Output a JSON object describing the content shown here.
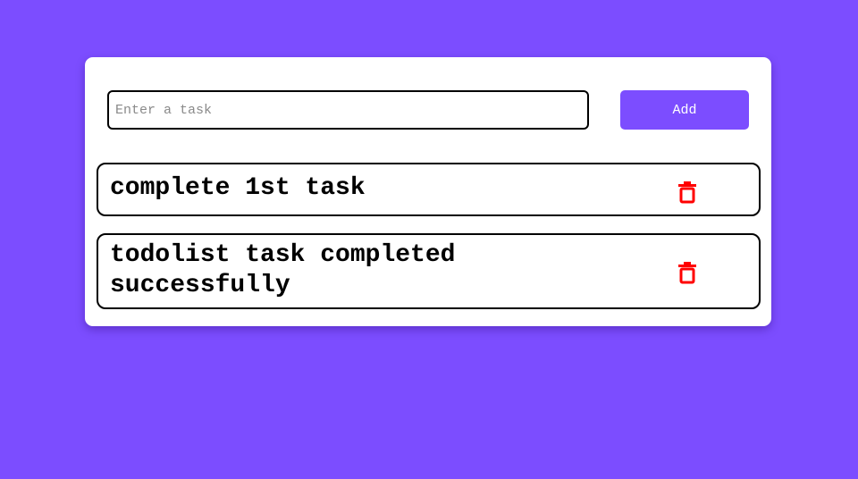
{
  "colors": {
    "background": "#7c4dff",
    "card": "#ffffff",
    "accent": "#7c4dff",
    "delete_icon": "#ff0000"
  },
  "input": {
    "placeholder": "Enter a task",
    "value": ""
  },
  "add_button": {
    "label": "Add"
  },
  "tasks": [
    {
      "text": "complete 1st task",
      "delete_icon": "trash-icon"
    },
    {
      "text": "todolist task completed successfully",
      "delete_icon": "trash-icon"
    }
  ]
}
